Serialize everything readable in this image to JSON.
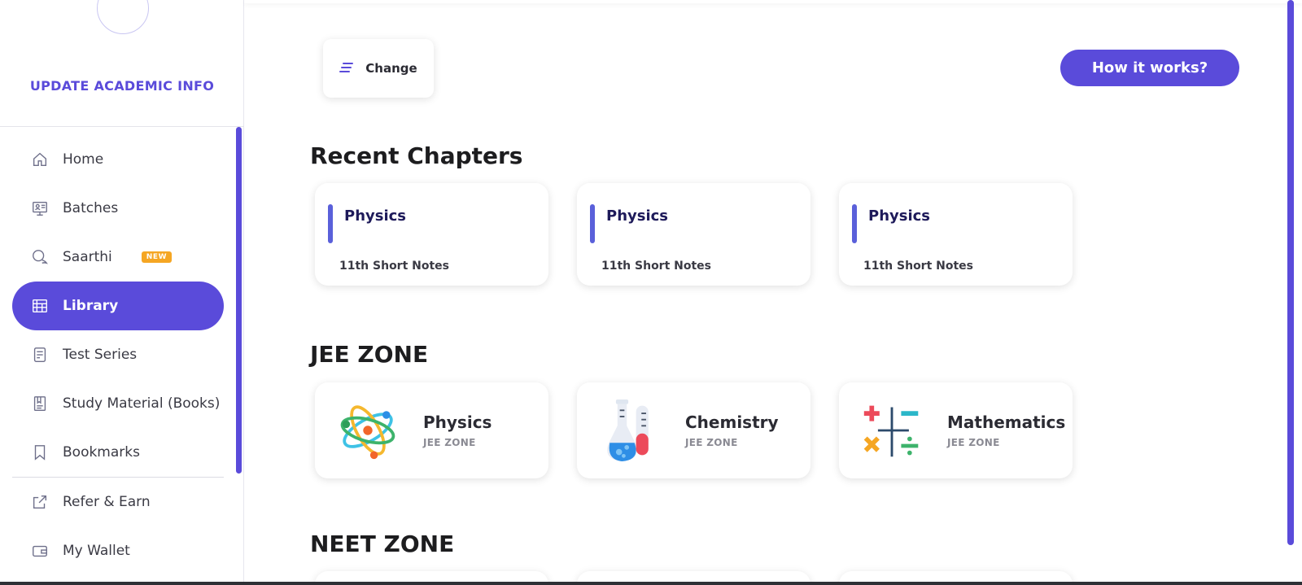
{
  "sidebar": {
    "update_link": "UPDATE ACADEMIC INFO",
    "items": [
      {
        "label": "Home",
        "icon": "home-icon"
      },
      {
        "label": "Batches",
        "icon": "batches-icon"
      },
      {
        "label": "Saarthi",
        "icon": "chat-bubbles-icon",
        "badge": "NEW"
      },
      {
        "label": "Library",
        "icon": "library-icon",
        "active": true
      },
      {
        "label": "Test Series",
        "icon": "test-series-icon"
      },
      {
        "label": "Study Material (Books)",
        "icon": "book-icon"
      },
      {
        "label": "Bookmarks",
        "icon": "bookmark-icon"
      },
      {
        "label": "Refer & Earn",
        "icon": "share-icon"
      },
      {
        "label": "My Wallet",
        "icon": "wallet-icon"
      }
    ]
  },
  "header": {
    "change_label": "Change",
    "how_label": "How it works?"
  },
  "recent": {
    "title": "Recent Chapters",
    "cards": [
      {
        "subject": "Physics",
        "sub": "11th Short Notes"
      },
      {
        "subject": "Physics",
        "sub": "11th Short Notes"
      },
      {
        "subject": "Physics",
        "sub": "11th Short Notes"
      }
    ]
  },
  "jee": {
    "title": "JEE ZONE",
    "cards": [
      {
        "title": "Physics",
        "sub": "JEE ZONE",
        "icon": "atom-icon"
      },
      {
        "title": "Chemistry",
        "sub": "JEE ZONE",
        "icon": "flask-icon"
      },
      {
        "title": "Mathematics",
        "sub": "JEE ZONE",
        "icon": "math-symbols-icon"
      }
    ]
  },
  "neet": {
    "title": "NEET ZONE"
  },
  "colors": {
    "accent": "#5a4bda",
    "badge": "#f5a623",
    "card_bar": "#5a60da"
  }
}
